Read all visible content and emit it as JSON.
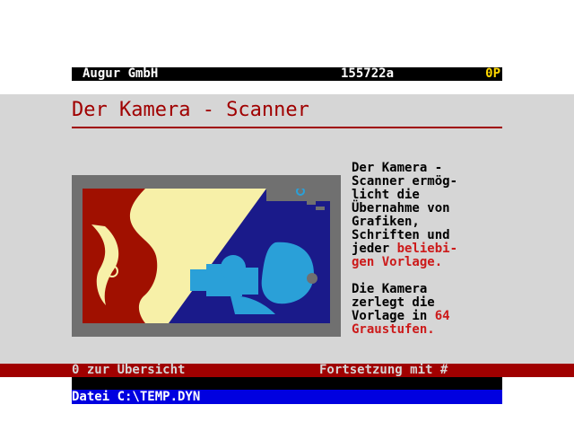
{
  "header": {
    "provider": "Augur GmbH",
    "page_number": "155722a",
    "flag": "0P"
  },
  "main": {
    "title": "Der Kamera - Scanner",
    "description": {
      "p1_line1": "Der Kamera -",
      "p1_line2": "Scanner ermög-",
      "p1_line3": "licht die",
      "p1_line4": "Übernahme von",
      "p1_line5": "Grafiken,",
      "p1_line6": "Schriften und",
      "p1_line7_a": "jeder ",
      "p1_line7_b": "beliebi-",
      "p1_line8": "gen Vorlage.",
      "p2_line1": "Die Kamera",
      "p2_line2": "zerlegt die",
      "p2_line3_a": "Vorlage in ",
      "p2_line3_b": "64",
      "p2_line4": "Graustufen."
    }
  },
  "footer": {
    "overview_link": "0 zur Übersicht",
    "continue_link": "Fortsetzung mit #",
    "status": "Datei C:\\TEMP.DYN"
  },
  "colors": {
    "header_bg": "#000000",
    "content_bg": "#d6d6d6",
    "accent_red": "#a00000",
    "highlight_red": "#cc1a1a",
    "status_blue": "#0000e0",
    "flag_yellow": "#ffd800"
  }
}
